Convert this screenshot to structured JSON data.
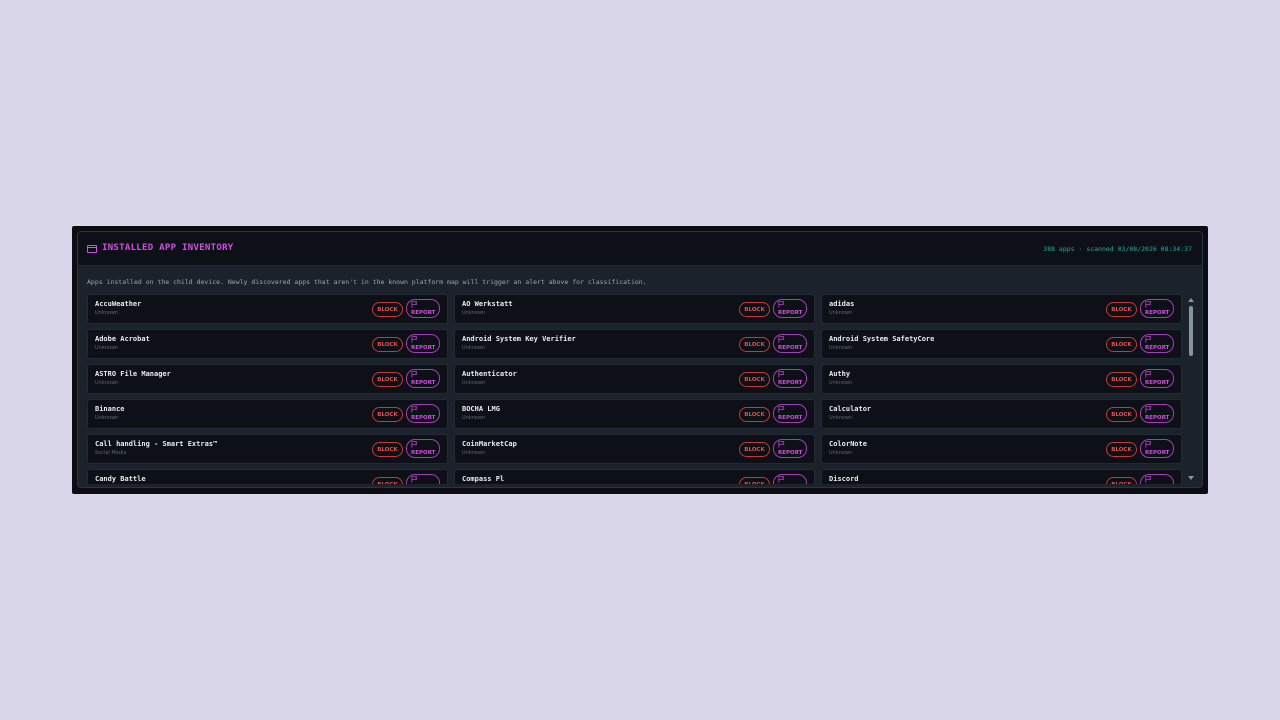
{
  "header": {
    "title": "INSTALLED APP INVENTORY",
    "meta": "388 apps · scanned 03/08/2026 08:34:37",
    "icon": "window-icon"
  },
  "description": "Apps installed on the child device. Newly discovered apps that aren't in the known platform map will trigger an alert above for classification.",
  "actions": {
    "block_label": "BLOCK",
    "report_label": "REPORT"
  },
  "colors": {
    "accent": "#d04fe0",
    "block": "#e0524e",
    "meta": "#2fa99b"
  },
  "apps": [
    {
      "name": "AccuWeather",
      "category": "Unknown"
    },
    {
      "name": "AO Werkstatt",
      "category": "Unknown"
    },
    {
      "name": "adidas",
      "category": "Unknown"
    },
    {
      "name": "Adobe Acrobat",
      "category": "Unknown"
    },
    {
      "name": "Android System Key Verifier",
      "category": "Unknown"
    },
    {
      "name": "Android System SafetyCore",
      "category": "Unknown"
    },
    {
      "name": "ASTRO File Manager",
      "category": "Unknown"
    },
    {
      "name": "Authenticator",
      "category": "Unknown"
    },
    {
      "name": "Authy",
      "category": "Unknown"
    },
    {
      "name": "Binance",
      "category": "Unknown"
    },
    {
      "name": "BOCHA LMG",
      "category": "Unknown"
    },
    {
      "name": "Calculator",
      "category": "Unknown"
    },
    {
      "name": "Call handling - Smart Extras™",
      "category": "Social Media"
    },
    {
      "name": "CoinMarketCap",
      "category": "Unknown"
    },
    {
      "name": "ColorNote",
      "category": "Unknown"
    },
    {
      "name": "Candy Battle",
      "category": ""
    },
    {
      "name": "Compass Pl",
      "category": ""
    },
    {
      "name": "Discord",
      "category": ""
    }
  ]
}
